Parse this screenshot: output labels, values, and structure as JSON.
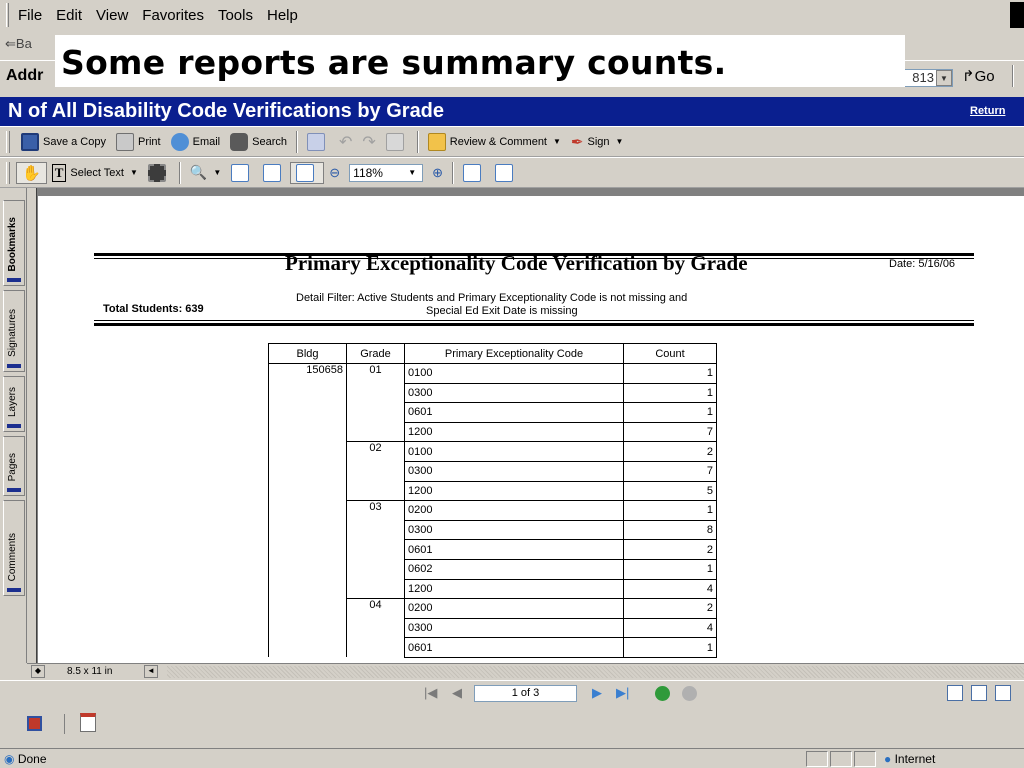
{
  "menu": {
    "items": [
      "File",
      "Edit",
      "View",
      "Favorites",
      "Tools",
      "Help"
    ]
  },
  "navbar": {
    "back_label": "Ba"
  },
  "address": {
    "label": "Addr",
    "dropdown_value": "813",
    "go_label": "Go"
  },
  "caption": "Some reports are summary counts.",
  "titlebar": {
    "title": "N of All Disability Code Verifications by Grade",
    "return_label": "Return"
  },
  "toolbar1": {
    "save_label": "Save a Copy",
    "print_label": "Print",
    "email_label": "Email",
    "search_label": "Search",
    "review_label": "Review & Comment",
    "sign_label": "Sign"
  },
  "toolbar2": {
    "select_text_label": "Select Text",
    "zoom_value": "118%"
  },
  "side_tabs": [
    "Bookmarks",
    "Signatures",
    "Layers",
    "Pages",
    "Comments"
  ],
  "report": {
    "title": "Primary Exceptionality Code Verification by Grade",
    "date": "Date: 5/16/06",
    "total_students": "Total Students: 639",
    "filter_line1": "Detail Filter:  Active Students  and  Primary Exceptionality Code  is not missing  and",
    "filter_line2": "Special Ed Exit Date  is missing",
    "columns": [
      "Bldg",
      "Grade",
      "Primary Exceptionality Code",
      "Count"
    ],
    "rows": [
      {
        "bldg": "150658",
        "grade": "01",
        "code": "0100",
        "count": "1"
      },
      {
        "bldg": "",
        "grade": "",
        "code": "0300",
        "count": "1"
      },
      {
        "bldg": "",
        "grade": "",
        "code": "0601",
        "count": "1"
      },
      {
        "bldg": "",
        "grade": "",
        "code": "1200",
        "count": "7"
      },
      {
        "bldg": "",
        "grade": "02",
        "code": "0100",
        "count": "2"
      },
      {
        "bldg": "",
        "grade": "",
        "code": "0300",
        "count": "7"
      },
      {
        "bldg": "",
        "grade": "",
        "code": "1200",
        "count": "5"
      },
      {
        "bldg": "",
        "grade": "03",
        "code": "0200",
        "count": "1"
      },
      {
        "bldg": "",
        "grade": "",
        "code": "0300",
        "count": "8"
      },
      {
        "bldg": "",
        "grade": "",
        "code": "0601",
        "count": "2"
      },
      {
        "bldg": "",
        "grade": "",
        "code": "0602",
        "count": "1"
      },
      {
        "bldg": "",
        "grade": "",
        "code": "1200",
        "count": "4"
      },
      {
        "bldg": "",
        "grade": "04",
        "code": "0200",
        "count": "2"
      },
      {
        "bldg": "",
        "grade": "",
        "code": "0300",
        "count": "4"
      },
      {
        "bldg": "",
        "grade": "",
        "code": "0601",
        "count": "1"
      }
    ]
  },
  "doc_status": {
    "page_size": "8.5 x 11 in"
  },
  "pagenav": {
    "page_indicator": "1 of 3"
  },
  "status": {
    "text": "Done",
    "zone": "Internet"
  },
  "colors": {
    "titlebar": "#0a1f8f",
    "chrome": "#d4d0c8",
    "doc_bg": "#808080"
  }
}
